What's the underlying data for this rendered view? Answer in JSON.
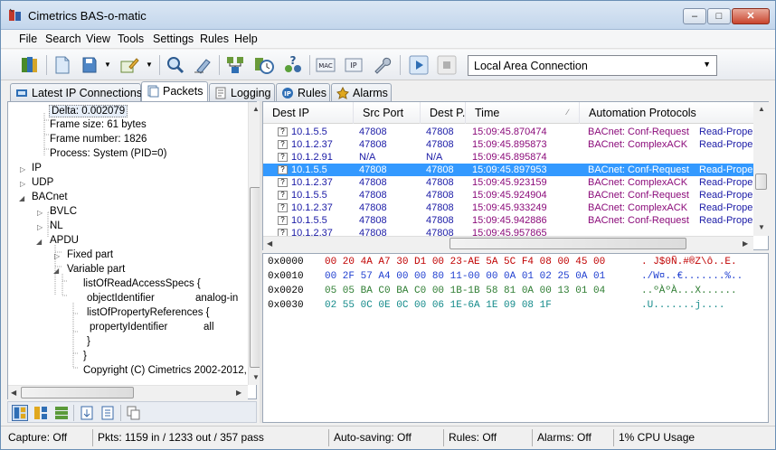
{
  "window": {
    "title": "Cimetrics BAS-o-matic"
  },
  "menu": [
    "File",
    "Search",
    "View",
    "Tools",
    "Settings",
    "Rules",
    "Help"
  ],
  "toolbar": {
    "connection": "Local Area Connection",
    "mac_label": "MAC",
    "ip_label": "IP"
  },
  "tabs": [
    "Latest IP Connections",
    "Packets",
    "Logging",
    "Rules",
    "Alarms"
  ],
  "tree": {
    "delta": "Delta: 0.002079",
    "frame_size": "Frame size: 61 bytes",
    "frame_number": "Frame number: 1826",
    "process": "Process: System (PID=0)",
    "ip": "IP",
    "udp": "UDP",
    "bacnet": "BACnet",
    "bvlc": "BVLC",
    "nl": "NL",
    "apdu": "APDU",
    "fixed_part": "Fixed part",
    "variable_part": "Variable part",
    "list_specs": "listOfReadAccessSpecs {",
    "object_id": "objectIdentifier",
    "object_id_val": "analog-in",
    "list_props": "listOfPropertyReferences {",
    "prop_id": "propertyIdentifier",
    "prop_id_val": "all",
    "close1": "}",
    "close2": "}",
    "copyright": "Copyright (C) Cimetrics 2002-2012,"
  },
  "grid": {
    "columns": [
      "Dest IP",
      "Src Port",
      "Dest P...",
      "Time",
      "Automation Protocols"
    ],
    "rows": [
      {
        "dest_ip": "10.1.5.5",
        "src_port": "47808",
        "dest_port": "47808",
        "time": "15:09:45.870474",
        "protocol": "BACnet: Conf-Request",
        "service": "Read-Prope"
      },
      {
        "dest_ip": "10.1.2.37",
        "src_port": "47808",
        "dest_port": "47808",
        "time": "15:09:45.895873",
        "protocol": "BACnet: ComplexACK",
        "service": "Read-Prope"
      },
      {
        "dest_ip": "10.1.2.91",
        "src_port": "N/A",
        "dest_port": "N/A",
        "time": "15:09:45.895874",
        "protocol": "",
        "service": ""
      },
      {
        "dest_ip": "10.1.5.5",
        "src_port": "47808",
        "dest_port": "47808",
        "time": "15:09:45.897953",
        "protocol": "BACnet: Conf-Request",
        "service": "Read-Prope"
      },
      {
        "dest_ip": "10.1.2.37",
        "src_port": "47808",
        "dest_port": "47808",
        "time": "15:09:45.923159",
        "protocol": "BACnet: ComplexACK",
        "service": "Read-Prope"
      },
      {
        "dest_ip": "10.1.5.5",
        "src_port": "47808",
        "dest_port": "47808",
        "time": "15:09:45.924904",
        "protocol": "BACnet: Conf-Request",
        "service": "Read-Prope"
      },
      {
        "dest_ip": "10.1.2.37",
        "src_port": "47808",
        "dest_port": "47808",
        "time": "15:09:45.933249",
        "protocol": "BACnet: ComplexACK",
        "service": "Read-Prope"
      },
      {
        "dest_ip": "10.1.5.5",
        "src_port": "47808",
        "dest_port": "47808",
        "time": "15:09:45.942886",
        "protocol": "BACnet: Conf-Request",
        "service": "Read-Prope"
      },
      {
        "dest_ip": "10.1.2.37",
        "src_port": "47808",
        "dest_port": "47808",
        "time": "15:09:45.957865",
        "protocol": "",
        "service": ""
      }
    ]
  },
  "hex": [
    {
      "offset": "0x0000",
      "a": "00 20 4A A7 30 D1 00 23-AE 5A 5C F4 08 00 45 00",
      "ascii": ". J$0Ñ.#®Z\\ô..E."
    },
    {
      "offset": "0x0010",
      "a": "00 2F 57 A4 00 00 80 11-00 00 0A 01 02 25 0A 01",
      "ascii": "./W¤..€.......%.."
    },
    {
      "offset": "0x0020",
      "a": "05 05 BA C0 BA C0 00 1B-1B 58 81 0A 00 13 01 04",
      "ascii": "..ºÀºÀ...X......"
    },
    {
      "offset": "0x0030",
      "a": "02 55 0C 0E 0C 00 06 1E-6A 1E 09 08 1F",
      "ascii": ".U.......j...."
    }
  ],
  "status": {
    "capture": "Capture: Off",
    "packets": "Pkts: 1159 in / 1233 out / 357 pass",
    "autosave": "Auto-saving: Off",
    "rules": "Rules: Off",
    "alarms": "Alarms: Off",
    "cpu": "1% CPU Usage"
  },
  "colors": {
    "selection": "#3399ff",
    "row_text": "#1a1aa6",
    "protocol_text": "#8b0b7a",
    "time_text": "#8b0b7a",
    "hex_red": "#c00000",
    "hex_blue": "#1f3fd0",
    "hex_green": "#2e7d32"
  }
}
